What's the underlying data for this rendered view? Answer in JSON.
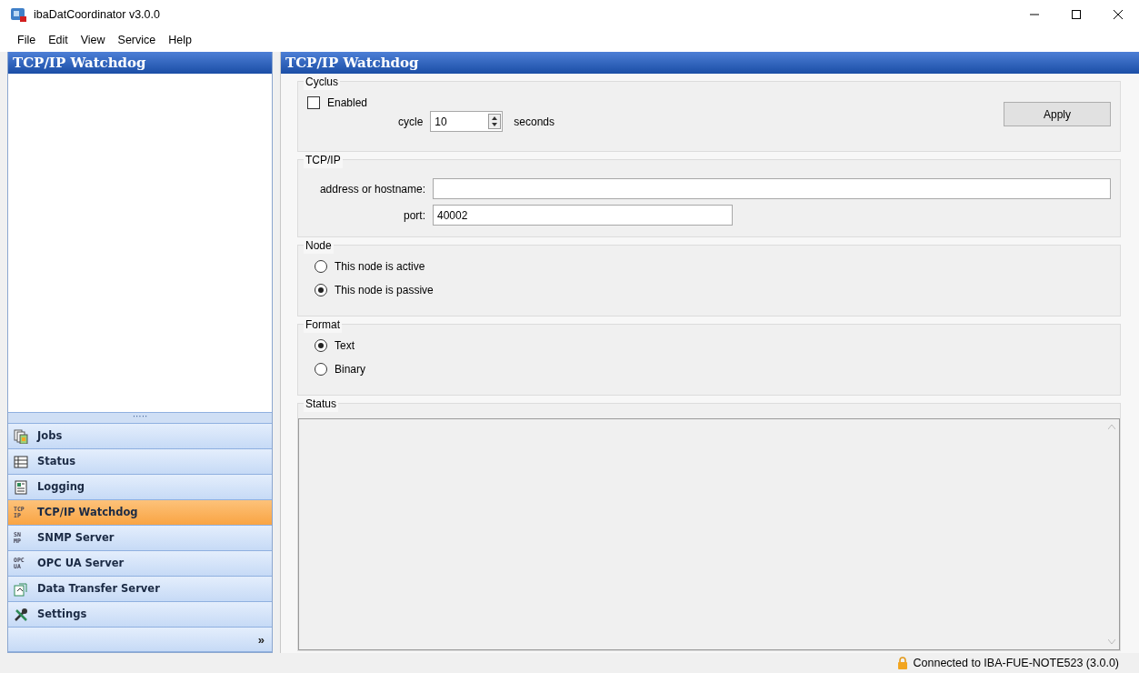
{
  "window": {
    "title": "ibaDatCoordinator v3.0.0"
  },
  "menu": [
    {
      "label": "File"
    },
    {
      "label": "Edit"
    },
    {
      "label": "View"
    },
    {
      "label": "Service"
    },
    {
      "label": "Help"
    }
  ],
  "sidebar": {
    "title": "TCP/IP Watchdog",
    "splitter": "·····",
    "items": [
      {
        "label": "Jobs",
        "kind": "jobs",
        "selected": false
      },
      {
        "label": "Status",
        "kind": "table",
        "selected": false
      },
      {
        "label": "Logging",
        "kind": "log",
        "selected": false
      },
      {
        "label": "TCP/IP Watchdog",
        "kind": "text",
        "icon_text": [
          "TCP",
          "IP"
        ],
        "selected": true
      },
      {
        "label": "SNMP Server",
        "kind": "text",
        "icon_text": [
          "SN",
          "MP"
        ],
        "selected": false
      },
      {
        "label": "OPC UA Server",
        "kind": "text",
        "icon_text": [
          "OPC",
          "UA"
        ],
        "selected": false
      },
      {
        "label": "Data Transfer Server",
        "kind": "transfer",
        "selected": false
      },
      {
        "label": "Settings",
        "kind": "tools",
        "selected": false
      }
    ],
    "more": "»"
  },
  "panel": {
    "title": "TCP/IP Watchdog",
    "cyclus": {
      "legend": "Cyclus",
      "enabled": {
        "label": "Enabled",
        "checked": false
      },
      "cycle_label": "cycle",
      "cycle_value": "10",
      "unit": "seconds",
      "apply": "Apply"
    },
    "tcpip": {
      "legend": "TCP/IP",
      "address_label": "address or hostname:",
      "port_label": "port:",
      "port_value": "40002"
    },
    "node": {
      "legend": "Node",
      "options": [
        {
          "label": "This node is active",
          "selected": false
        },
        {
          "label": "This node is passive",
          "selected": true
        }
      ]
    },
    "format": {
      "legend": "Format",
      "options": [
        {
          "label": "Text",
          "selected": true
        },
        {
          "label": "Binary",
          "selected": false
        }
      ]
    },
    "status": {
      "legend": "Status"
    }
  },
  "status_bar": {
    "text": "Connected to IBA-FUE-NOTE523 (3.0.0)"
  }
}
